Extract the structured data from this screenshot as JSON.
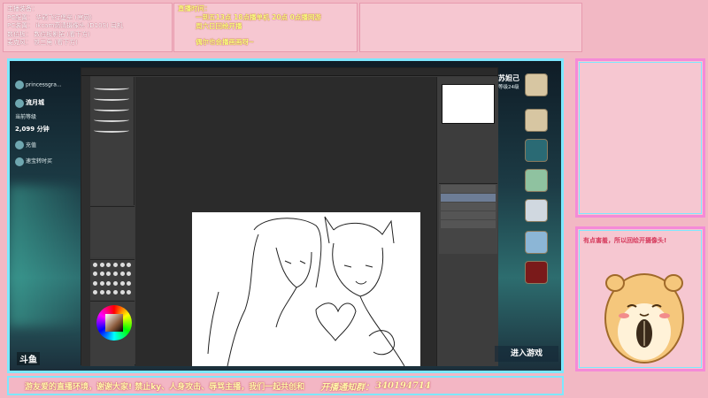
{
  "header": {
    "left_lines": [
      "主播装备：",
      "PC配置： 华硕飞行堡垒 (官网)",
      "PC装置： ikcam高清摄像头 (D10S) 耳机",
      "数位板： 数位板影拓 (看下方)",
      "麦克风： 铁三角 (看下方)"
    ],
    "live_time_title": "直播时间：",
    "live_time_lines": [
      "一到五13点 18点播单机 20点 0点播网游",
      "周六日回绘开播",
      "偶尔也会播画画呀~"
    ]
  },
  "game_left": {
    "user": "princessgra...",
    "guild": "流月城",
    "level_label": "当前等级",
    "score": "2,099 分钟",
    "item1": "充值",
    "item2": "速宝转时买"
  },
  "game_right": {
    "player_name": "苏妲己",
    "player_sub": "等级24级",
    "enter_button": "进入游戏"
  },
  "side_notice": "有点害羞，所以回绘开摄像头!",
  "footer": {
    "message": "游友爱的直播环境，谢谢大家!    禁止ky、人身攻击、辱骂主播，我们一起共创和",
    "qq_label": "开播通知群：",
    "qq_number": "340194714"
  },
  "brand": {
    "logo": "斗鱼"
  },
  "colors": {
    "background": "#f2b8c4",
    "frame_cyan": "#7de8ff",
    "frame_pink": "#f58ad8",
    "notice_red": "#d53a5c",
    "yellow_text": "#fff9a8"
  }
}
